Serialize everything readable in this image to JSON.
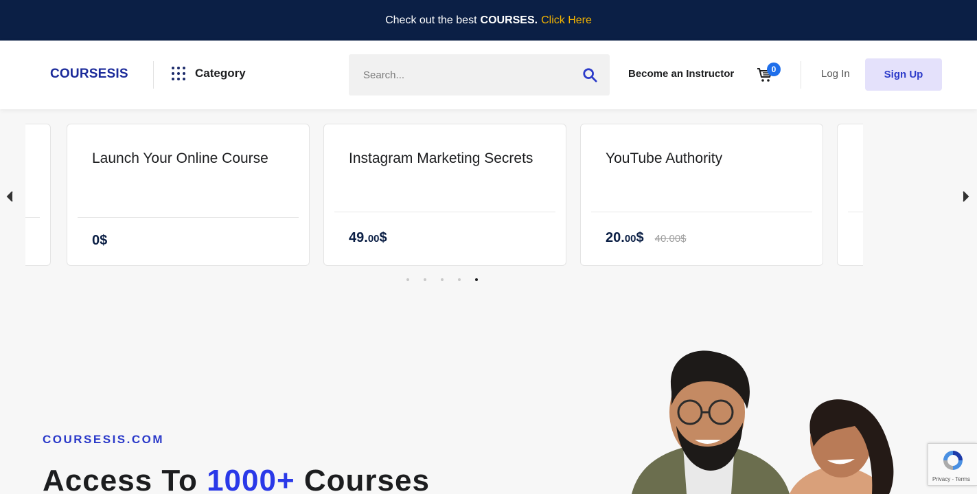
{
  "announcement": {
    "prefix": "Check out the best",
    "bold": "COURSES.",
    "link": "Click Here"
  },
  "header": {
    "logo": "COURSESIS",
    "category_label": "Category",
    "search_placeholder": "Search...",
    "instructor_label": "Become an Instructor",
    "cart_count": "0",
    "login_label": "Log In",
    "signup_label": "Sign Up"
  },
  "carousel": {
    "cards": [
      {
        "title": "Launch Your Online Course",
        "price_main": "0$",
        "price_cents": "",
        "price_suffix": "",
        "old_price": ""
      },
      {
        "title": "Instagram Marketing Secrets",
        "price_main": "49.",
        "price_cents": "00",
        "price_suffix": "$",
        "old_price": ""
      },
      {
        "title": "YouTube Authority",
        "price_main": "20.",
        "price_cents": "00",
        "price_suffix": "$",
        "old_price": "40.00$"
      }
    ],
    "pages": 5,
    "active_page": 5
  },
  "hero": {
    "domain": "COURSESIS.COM",
    "title_prefix": "Access To",
    "title_accent": "1000+",
    "title_suffix": "Courses"
  },
  "recaptcha": {
    "text": "Privacy - Terms"
  },
  "colors": {
    "topbar_bg": "#0b1f45",
    "accent": "#2a39e8",
    "link_yellow": "#f4b400",
    "signup_bg": "#e4e1fb"
  }
}
